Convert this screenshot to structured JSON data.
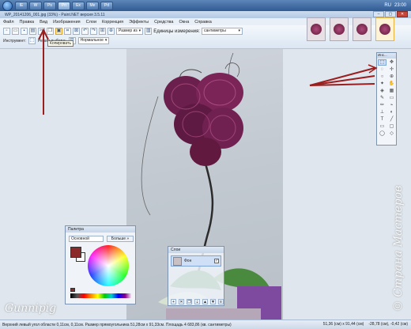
{
  "taskbar": {
    "apps": [
      "IE",
      "W",
      "Ps",
      "Pn",
      "Ex",
      "Me",
      "Pd"
    ],
    "tray_lang": "RU",
    "clock": "23:00"
  },
  "window": {
    "title": "WP_20141206_001.jpg (33%) - Paint.NET версия 3.5.11",
    "controls": [
      "–",
      "▢",
      "✕"
    ]
  },
  "menu": {
    "items": [
      "Файл",
      "Правка",
      "Вид",
      "Изображения",
      "Слои",
      "Коррекция",
      "Эффекты",
      "Средства",
      "Окна",
      "Справка"
    ]
  },
  "toolbar": {
    "size_label": "Размер из",
    "units_label": "Единицы измерения:",
    "units_value": "сантиметры",
    "instrument_label": "Инструмент:",
    "selection_mode_label": "Режим выбора:",
    "blend_mode": "Нормальное",
    "tooltip": "Копировать"
  },
  "palette": {
    "title": "Палитра",
    "mode": "Основной",
    "more_button": "Больше »"
  },
  "layers": {
    "title": "Слои",
    "layer_name": "Фон"
  },
  "tools_window": {
    "title": "Инс..."
  },
  "status": {
    "left": "Верхний левый угол области 0,11см, 0,11см. Размер прямоугольника 51,28см x 91,33см. Площадь 4 683,86 (кв. сантиметры)",
    "size": "51,36 (см) x 91,44 (см)",
    "position": "-28,78 (см), -0,42 (см)"
  },
  "watermarks": {
    "left": "Gunnipig",
    "right": "© Страна Мастеров"
  },
  "colors": {
    "accent": "#2f5a93",
    "primary_color": "#8a2a2a",
    "arrow": "#9a1e1e"
  }
}
